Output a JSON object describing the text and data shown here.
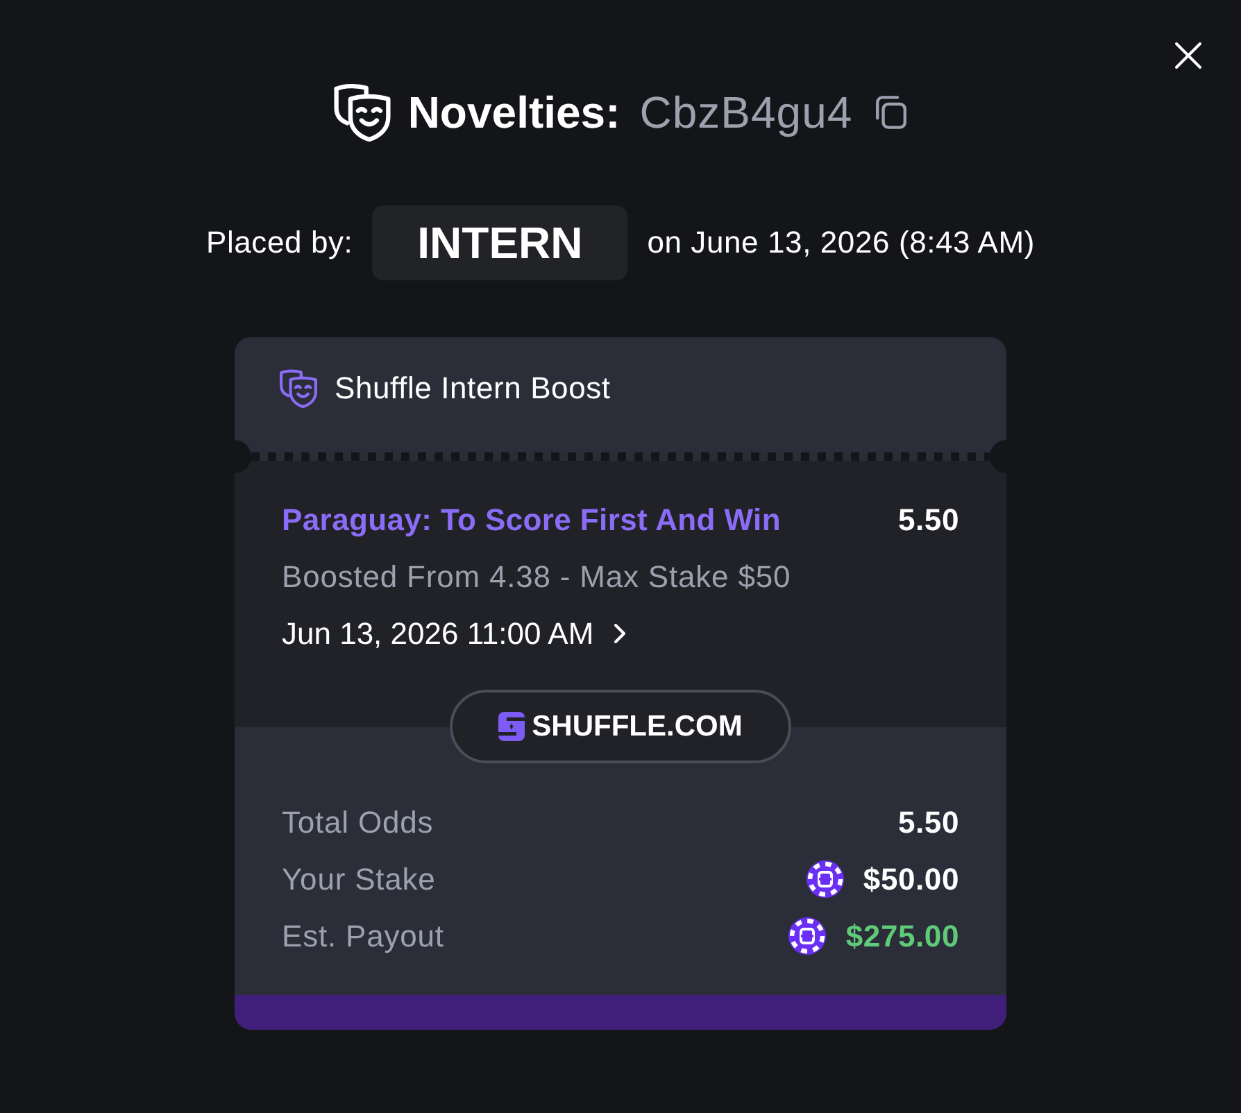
{
  "header": {
    "title": "Novelties:",
    "code": "CbzB4gu4"
  },
  "placed_by": {
    "label": "Placed by:",
    "user": "INTERN",
    "date": "on June 13, 2026 (8:43 AM)"
  },
  "ticket": {
    "title": "Shuffle Intern Boost",
    "selection": {
      "market": "Paraguay: To Score First And Win",
      "odds": "5.50",
      "note": "Boosted From 4.38 - Max Stake $50",
      "event_time": "Jun 13, 2026 11:00 AM"
    },
    "brand": "SHUFFLE.COM",
    "summary": [
      {
        "kind": "odds",
        "label": "Total Odds",
        "value": "5.50"
      },
      {
        "kind": "amount",
        "label": "Your Stake",
        "value": "$50.00"
      },
      {
        "kind": "payout",
        "label": "Est. Payout",
        "value": "$275.00"
      }
    ]
  }
}
